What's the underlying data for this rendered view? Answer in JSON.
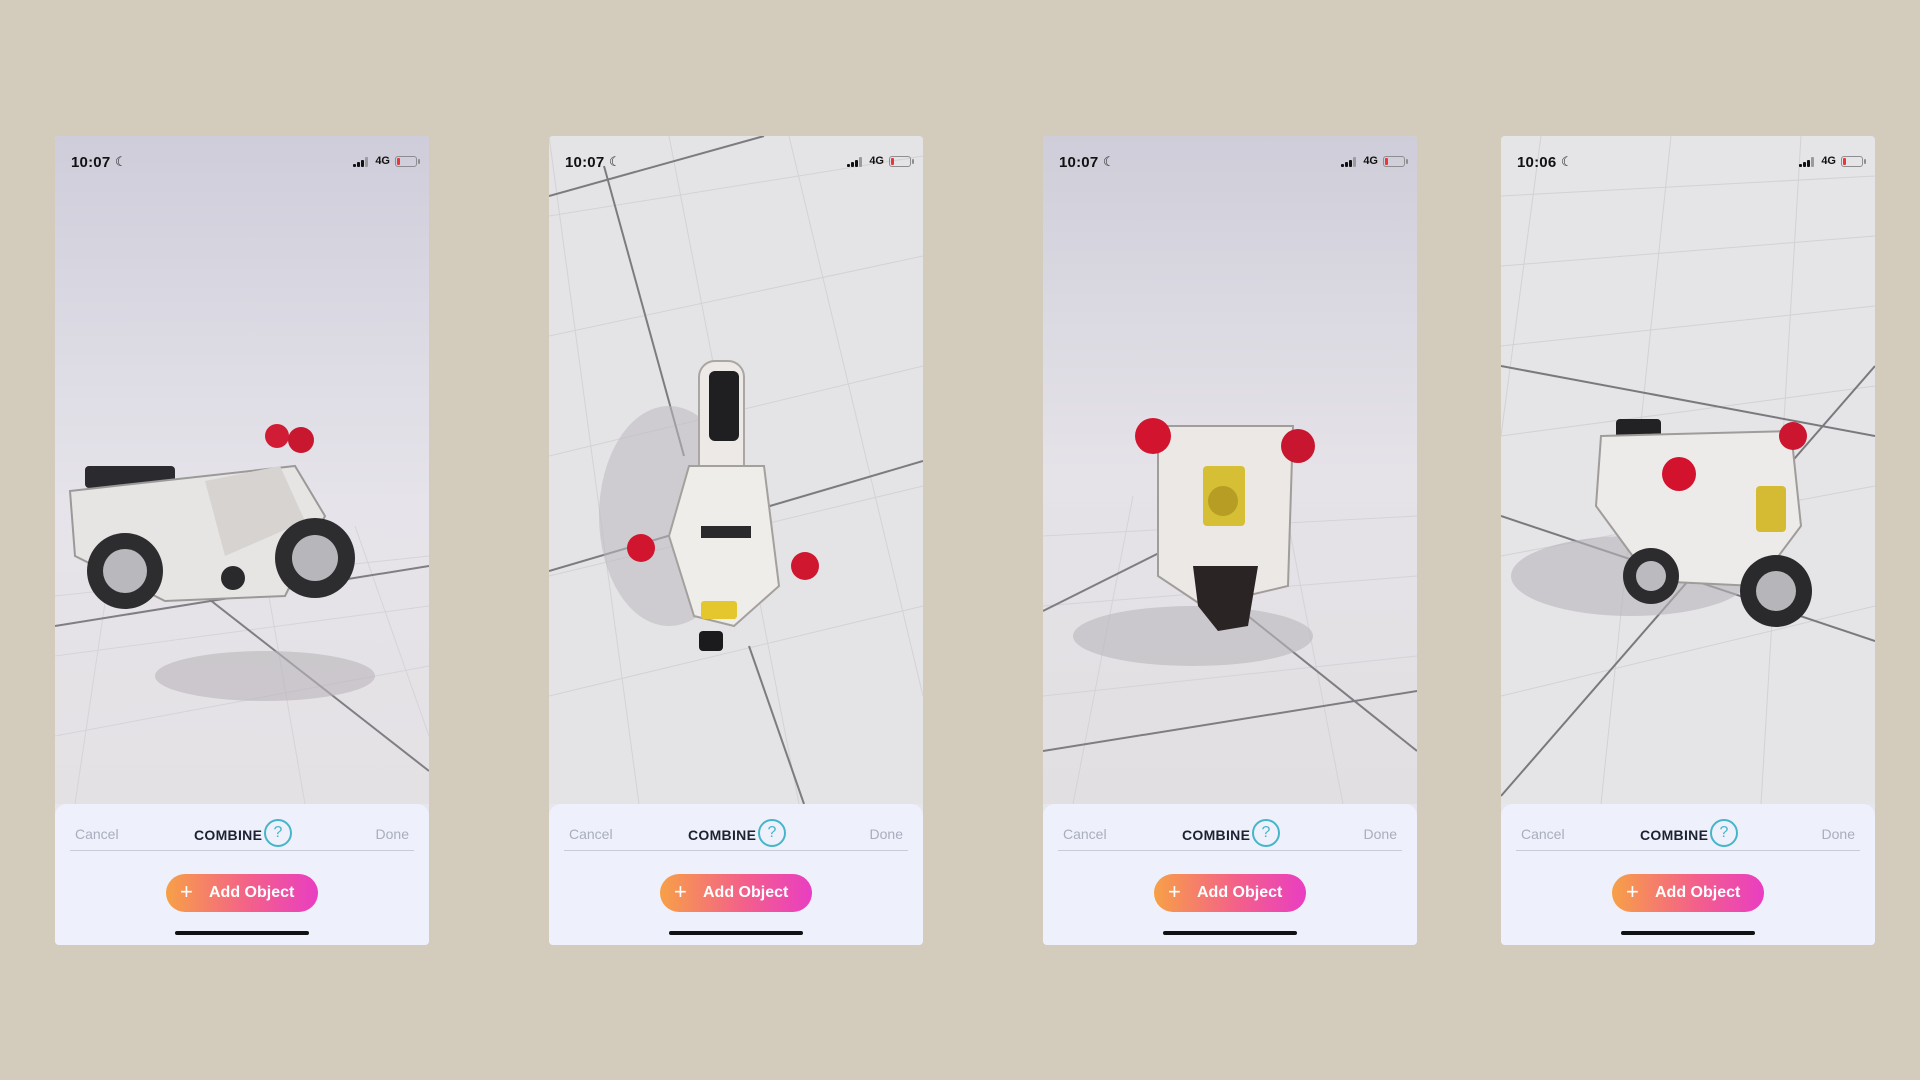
{
  "colors": {
    "background": "#d3cbbb",
    "panel": "#eef1fb",
    "accent_help": "#47b5c9",
    "button_gradient_start": "#f7a047",
    "button_gradient_end": "#e93ec2",
    "battery_low": "#e13a3a"
  },
  "phones": [
    {
      "status": {
        "time": "10:07",
        "network": "4G"
      },
      "panel": {
        "cancel_label": "Cancel",
        "title": "COMBINE",
        "help_glyph": "?",
        "done_label": "Done",
        "add_button_label": "Add Object",
        "add_icon": "plus-icon"
      },
      "view": "side view"
    },
    {
      "status": {
        "time": "10:07",
        "network": "4G"
      },
      "panel": {
        "cancel_label": "Cancel",
        "title": "COMBINE",
        "help_glyph": "?",
        "done_label": "Done",
        "add_button_label": "Add Object",
        "add_icon": "plus-icon"
      },
      "view": "top view"
    },
    {
      "status": {
        "time": "10:07",
        "network": "4G"
      },
      "panel": {
        "cancel_label": "Cancel",
        "title": "COMBINE",
        "help_glyph": "?",
        "done_label": "Done",
        "add_button_label": "Add Object",
        "add_icon": "plus-icon"
      },
      "view": "front view"
    },
    {
      "status": {
        "time": "10:06",
        "network": "4G"
      },
      "panel": {
        "cancel_label": "Cancel",
        "title": "COMBINE",
        "help_glyph": "?",
        "done_label": "Done",
        "add_button_label": "Add Object",
        "add_icon": "plus-icon"
      },
      "view": "three-quarter view"
    }
  ]
}
